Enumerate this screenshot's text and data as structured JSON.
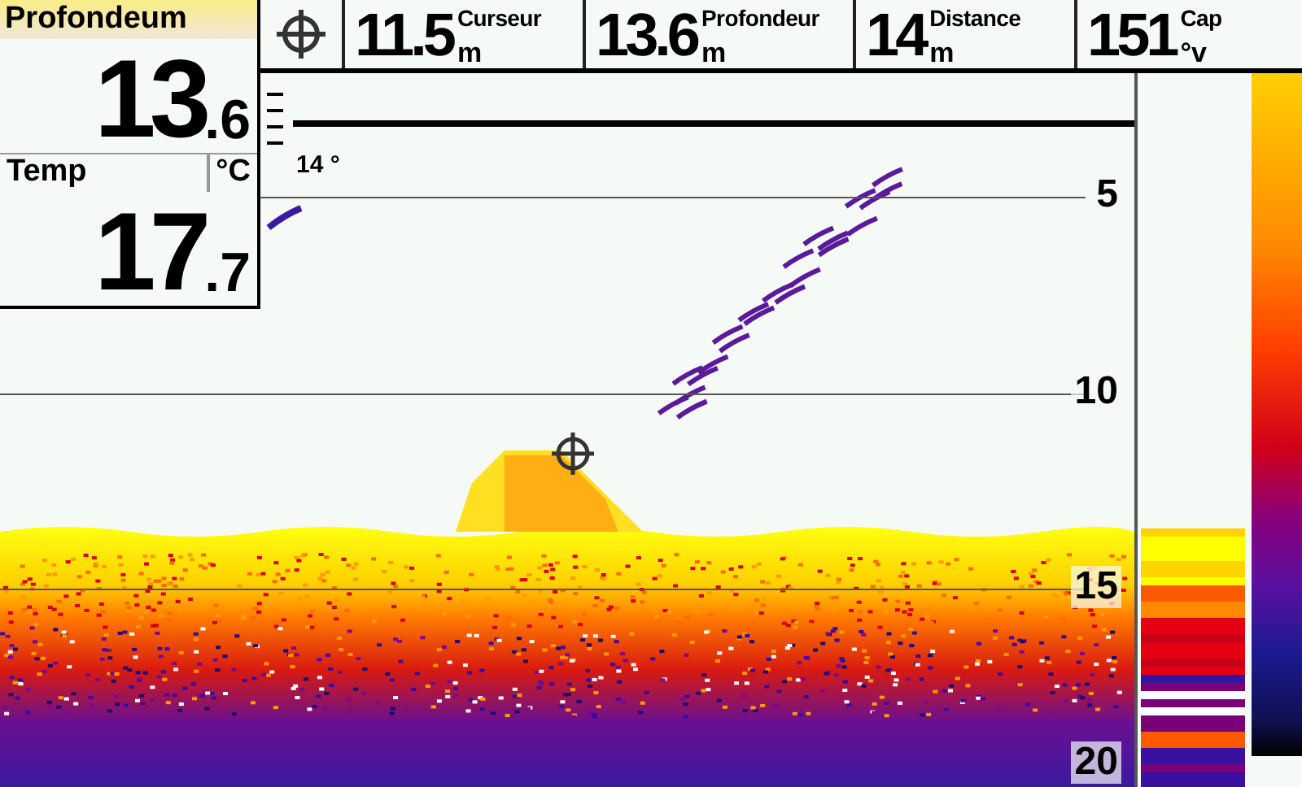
{
  "digital_readout": {
    "depth": {
      "label": "Profondeum",
      "whole": "13",
      "decimal": ".6"
    },
    "temperature": {
      "label": "Temp",
      "unit": "°C",
      "whole": "17",
      "decimal": ".7"
    }
  },
  "cursor_bar": {
    "readings": [
      {
        "label": "Curseur",
        "value": "11.5",
        "unit": "m"
      },
      {
        "label": "Profondeur",
        "value": "13.6",
        "unit": "m"
      },
      {
        "label": "Distance",
        "value": "14",
        "unit": "m"
      },
      {
        "label": "Cap",
        "value": "151",
        "unit": "°v"
      }
    ]
  },
  "sonar": {
    "temperature_marker": "14 °",
    "depth_scale": [
      "5",
      "10",
      "15",
      "20"
    ]
  }
}
